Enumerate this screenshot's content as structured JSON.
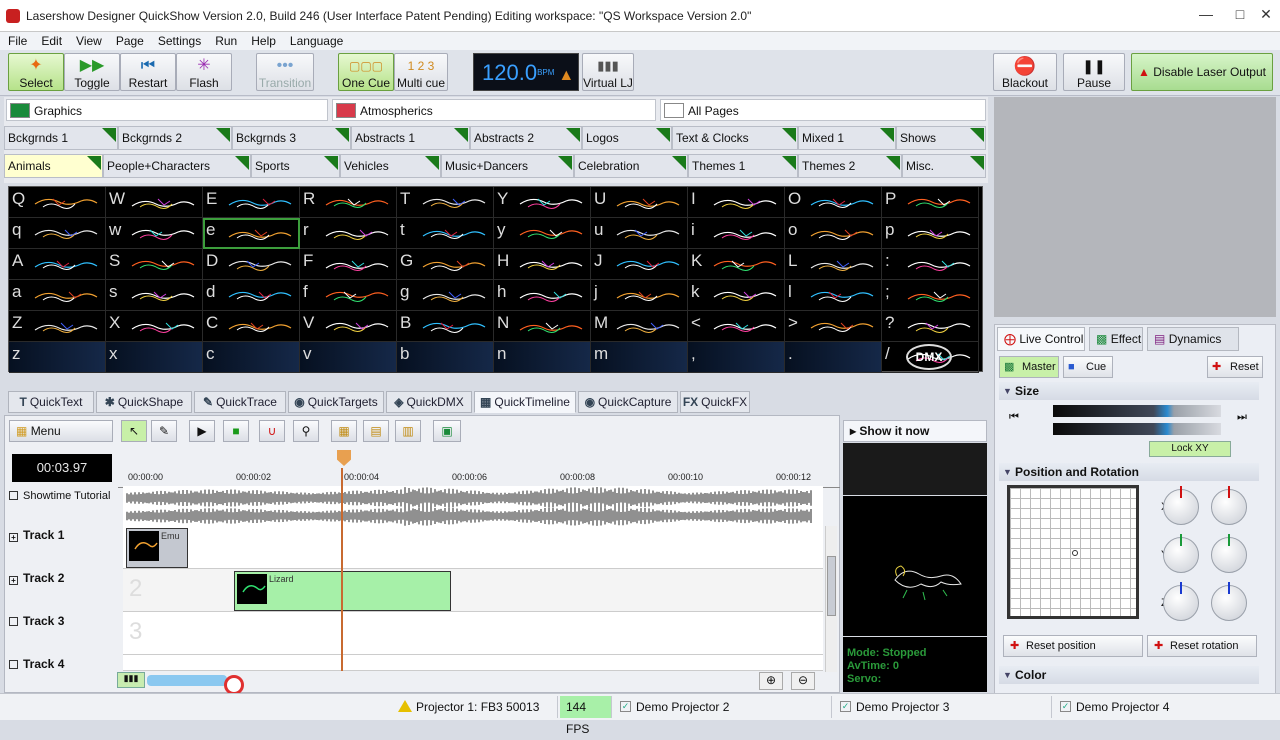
{
  "window": {
    "title": "Lasershow Designer QuickShow   Version 2.0, Build 246   (User Interface Patent Pending)   Editing workspace: \"QS Workspace Version 2.0\""
  },
  "menu": [
    "File",
    "Edit",
    "View",
    "Page",
    "Settings",
    "Run",
    "Help",
    "Language"
  ],
  "toolbar": {
    "select": "Select",
    "toggle": "Toggle",
    "restart": "Restart",
    "flash": "Flash",
    "transition": "Transition",
    "one_cue": "One Cue",
    "multi_cue": "Multi cue",
    "bpm": "120.0",
    "bpm_unit": "BPM",
    "virtual_lj": "Virtual LJ",
    "blackout": "Blackout",
    "pause": "Pause",
    "disable_laser": "Disable Laser Output"
  },
  "categories": {
    "graphics": "Graphics",
    "atmospherics": "Atmospherics",
    "all_pages": "All Pages"
  },
  "pages_row1": [
    "Bckgrnds 1",
    "Bckgrnds 2",
    "Bckgrnds 3",
    "Abstracts 1",
    "Abstracts 2",
    "Logos",
    "Text & Clocks",
    "Mixed 1",
    "Shows"
  ],
  "pages_row2": [
    "Animals",
    "People+Characters",
    "Sports",
    "Vehicles",
    "Music+Dancers",
    "Celebration",
    "Themes 1",
    "Themes 2",
    "Misc."
  ],
  "grid_keys": [
    [
      "Q",
      "W",
      "E",
      "R",
      "T",
      "Y",
      "U",
      "I",
      "O",
      "P"
    ],
    [
      "q",
      "w",
      "e",
      "r",
      "t",
      "y",
      "u",
      "i",
      "o",
      "p"
    ],
    [
      "A",
      "S",
      "D",
      "F",
      "G",
      "H",
      "J",
      "K",
      "L",
      ":"
    ],
    [
      "a",
      "s",
      "d",
      "f",
      "g",
      "h",
      "j",
      "k",
      "l",
      ";"
    ],
    [
      "Z",
      "X",
      "C",
      "V",
      "B",
      "N",
      "M",
      "<",
      ">",
      "?"
    ],
    [
      "z",
      "x",
      "c",
      "v",
      "b",
      "n",
      "m",
      ",",
      ".",
      "/"
    ]
  ],
  "grid_dmx": "DMX",
  "quick_tabs": [
    "QuickText",
    "QuickShape",
    "QuickTrace",
    "QuickTargets",
    "QuickDMX",
    "QuickTimeline",
    "QuickCapture",
    "QuickFX"
  ],
  "timeline": {
    "menu": "Menu",
    "time": "00:03.97",
    "ruler": [
      "00:00:00",
      "00:00:02",
      "00:00:04",
      "00:00:06",
      "00:00:08",
      "00:00:10",
      "00:00:12"
    ],
    "audio_track": "Showtime Tutorial",
    "tracks": [
      "Track 1",
      "Track 2",
      "Track 3",
      "Track 4"
    ],
    "lane_numbers": [
      "2",
      "3"
    ],
    "clip1": "Emu",
    "clip2": "Lizard"
  },
  "preview": {
    "show_it_now": "Show it now",
    "mode": "Mode:  Stopped",
    "avtime": "AvTime: 0",
    "servo": "Servo:"
  },
  "live_tabs": [
    "Live Control",
    "Effect",
    "Dynamics"
  ],
  "live": {
    "master": "Master",
    "cue": "Cue",
    "reset": "Reset",
    "size": "Size",
    "lock_xy": "Lock XY",
    "pos_rot": "Position and Rotation",
    "axes": [
      "X",
      "Y",
      "Z"
    ],
    "reset_position": "Reset position",
    "reset_rotation": "Reset rotation",
    "color": "Color"
  },
  "status": {
    "projector1": "Projector 1: FB3 50013",
    "fps": "144 FPS",
    "p2": "Demo Projector 2",
    "p3": "Demo Projector 3",
    "p4": "Demo Projector 4"
  }
}
